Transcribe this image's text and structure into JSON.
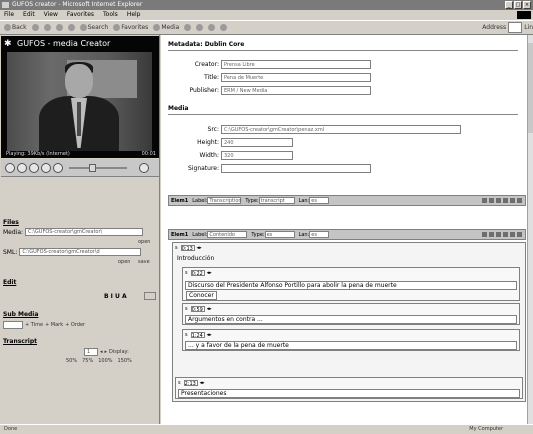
{
  "window": {
    "title": "GUFOS creator - Microsoft Internet Explorer",
    "controls": [
      "_",
      "□",
      "×"
    ]
  },
  "menu": [
    "File",
    "Edit",
    "View",
    "Favorites",
    "Tools",
    "Help"
  ],
  "toolbar": {
    "back": "Back",
    "search": "Search",
    "favorites": "Favorites",
    "media": "Media",
    "address_label": "Address",
    "address_value": "Lin"
  },
  "app": {
    "title": "GUFOS - media Creator"
  },
  "player": {
    "status_left": "Playing: 39Kb/s (Internet)",
    "status_right": "00:01"
  },
  "file": {
    "heading": "Files",
    "media_label": "Media:",
    "media_value": "C:\\GUFOS-creator\\gmCreator\\",
    "open1": "open",
    "sml_label": "SML:",
    "sml_value": "C:\\GUFOS-creator\\gmCreator\\d",
    "open2": "open",
    "save": "save"
  },
  "edit": {
    "heading": "Edit",
    "tools": "B I U A"
  },
  "subs": {
    "heading": "Sub Media",
    "time": "+ Time",
    "mark": "+ Mark",
    "order": "+ Order"
  },
  "transcript": {
    "heading": "Transcript",
    "page": "1",
    "display": "Display:",
    "zooms": [
      "50%",
      "75%",
      "100%",
      "150%"
    ]
  },
  "metadata": {
    "heading": "Metadata: Dublin Core",
    "fields": [
      {
        "label": "Creator:",
        "value": "Prensa Libre"
      },
      {
        "label": "Title:",
        "value": "Pena de Muerte"
      },
      {
        "label": "Publisher:",
        "value": "ERM / New Media"
      }
    ]
  },
  "media": {
    "heading": "Media",
    "fields": [
      {
        "label": "Src:",
        "value": "C:\\GUFOS-creator\\gmCreator\\penaz.xml"
      },
      {
        "label": "Height:",
        "value": "240"
      },
      {
        "label": "Width:",
        "value": "320"
      },
      {
        "label": "Signature:",
        "value": ""
      }
    ]
  },
  "element1": {
    "title": "Elem1",
    "label_text": "Label:",
    "label_value": "Transcription",
    "type_text": "Type:",
    "type_value": "transcript",
    "lan_text": "Lan:",
    "lan_value": "es"
  },
  "element2": {
    "title": "Elem1",
    "label_text": "Label:",
    "label_value": "Contenido",
    "type_text": "Type:",
    "type_value": "es",
    "lan_text": "Lan:",
    "lan_value": "es"
  },
  "segments": [
    {
      "time": "0:13",
      "text": "Introducción"
    },
    {
      "time": "0:22",
      "text": "Discurso del Presidente Alfonso Portillo para abolir la pena de muerte",
      "overlay": "Conocer"
    },
    {
      "time": "0:59",
      "text": "Argumentos en contra ..."
    },
    {
      "time": "1:24",
      "text": "... y a favor de la pena de muerte"
    },
    {
      "time": "2:13",
      "text": "Presentaciones"
    }
  ],
  "statusbar": {
    "left": "Done",
    "right": "My Computer"
  }
}
